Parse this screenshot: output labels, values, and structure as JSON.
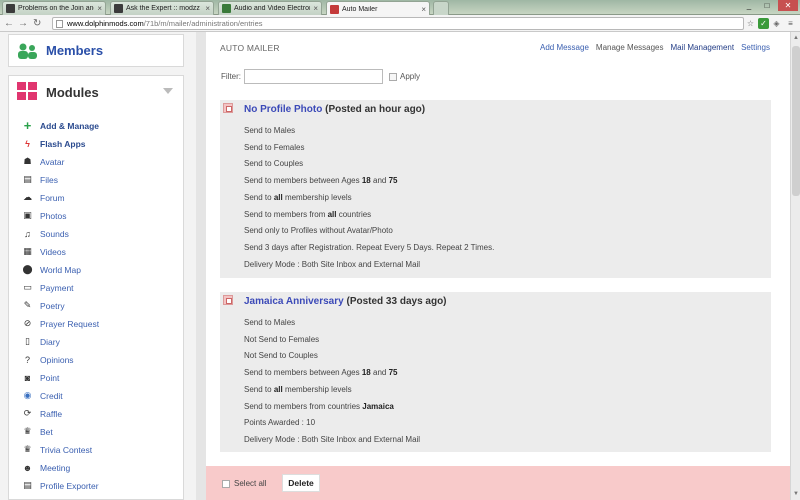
{
  "browser": {
    "tabs": [
      {
        "title": "Problems on the Join and",
        "active": false,
        "favicon": "dolphin-favicon"
      },
      {
        "title": "Ask the Expert :: modzz",
        "active": false,
        "favicon": "dolphin-favicon"
      },
      {
        "title": "Audio and Video Electron",
        "active": false,
        "favicon": "video-favicon"
      },
      {
        "title": "Auto Mailer",
        "active": true,
        "favicon": "dolphin-favicon"
      }
    ],
    "url_host": "www.dolphinmods.com",
    "url_path": "/71b/m/mailer/administration/entries",
    "window_controls": [
      "_",
      "□",
      "✕"
    ]
  },
  "sidebar": {
    "members_title": "Members",
    "modules_title": "Modules",
    "items": [
      {
        "label": "Add & Manage",
        "icon": "plus-icon",
        "bold": true
      },
      {
        "label": "Flash Apps",
        "icon": "flash-icon",
        "bold": true
      },
      {
        "label": "Avatar",
        "icon": "avatar-icon",
        "bold": false
      },
      {
        "label": "Files",
        "icon": "files-icon",
        "bold": false
      },
      {
        "label": "Forum",
        "icon": "forum-icon",
        "bold": false
      },
      {
        "label": "Photos",
        "icon": "photos-icon",
        "bold": false
      },
      {
        "label": "Sounds",
        "icon": "sounds-icon",
        "bold": false
      },
      {
        "label": "Videos",
        "icon": "videos-icon",
        "bold": false
      },
      {
        "label": "World Map",
        "icon": "map-pin-icon",
        "bold": false
      },
      {
        "label": "Payment",
        "icon": "payment-icon",
        "bold": false
      },
      {
        "label": "Poetry",
        "icon": "pencil-icon",
        "bold": false
      },
      {
        "label": "Prayer Request",
        "icon": "paperclip-icon",
        "bold": false
      },
      {
        "label": "Diary",
        "icon": "diary-icon",
        "bold": false
      },
      {
        "label": "Opinions",
        "icon": "question-icon",
        "bold": false
      },
      {
        "label": "Point",
        "icon": "point-icon",
        "bold": false
      },
      {
        "label": "Credit",
        "icon": "credit-icon",
        "bold": false
      },
      {
        "label": "Raffle",
        "icon": "raffle-icon",
        "bold": false
      },
      {
        "label": "Bet",
        "icon": "trophy-icon",
        "bold": false
      },
      {
        "label": "Trivia Contest",
        "icon": "trophy-icon",
        "bold": false
      },
      {
        "label": "Meeting",
        "icon": "meeting-icon",
        "bold": false
      },
      {
        "label": "Profile Exporter",
        "icon": "exporter-icon",
        "bold": false
      }
    ]
  },
  "main": {
    "header_title": "AUTO MAILER",
    "links": [
      "Add Message",
      "Manage Messages",
      "Mail Management",
      "Settings"
    ],
    "filter_label": "Filter:",
    "filter_value": "",
    "apply_label": "Apply",
    "entries": [
      {
        "name": "No Profile Photo",
        "posted": "(Posted an hour ago)",
        "lines": [
          [
            "Send to Males"
          ],
          [
            "Send to Females"
          ],
          [
            "Send to Couples"
          ],
          [
            "Send to members between Ages ",
            "18",
            " and ",
            "75"
          ],
          [
            "Send to ",
            "all",
            " membership levels"
          ],
          [
            "Send to members from ",
            "all",
            " countries"
          ],
          [
            "Send only to Profiles without Avatar/Photo"
          ],
          [
            "Send 3 days after Registration. Repeat Every 5 Days. Repeat 2 Times."
          ],
          [
            "Delivery Mode : Both Site Inbox and External Mail"
          ]
        ]
      },
      {
        "name": "Jamaica Anniversary",
        "posted": "(Posted 33 days ago)",
        "lines": [
          [
            "Send to Males"
          ],
          [
            "Not Send to Females"
          ],
          [
            "Not Send to Couples"
          ],
          [
            "Send to members between Ages ",
            "18",
            " and ",
            "75"
          ],
          [
            "Send to ",
            "all",
            " membership levels"
          ],
          [
            "Send to members from countries ",
            "Jamaica"
          ],
          [
            "Points Awarded : 10"
          ],
          [
            "Delivery Mode : Both Site Inbox and External Mail"
          ]
        ]
      }
    ],
    "select_all_label": "Select all",
    "delete_label": "Delete"
  }
}
